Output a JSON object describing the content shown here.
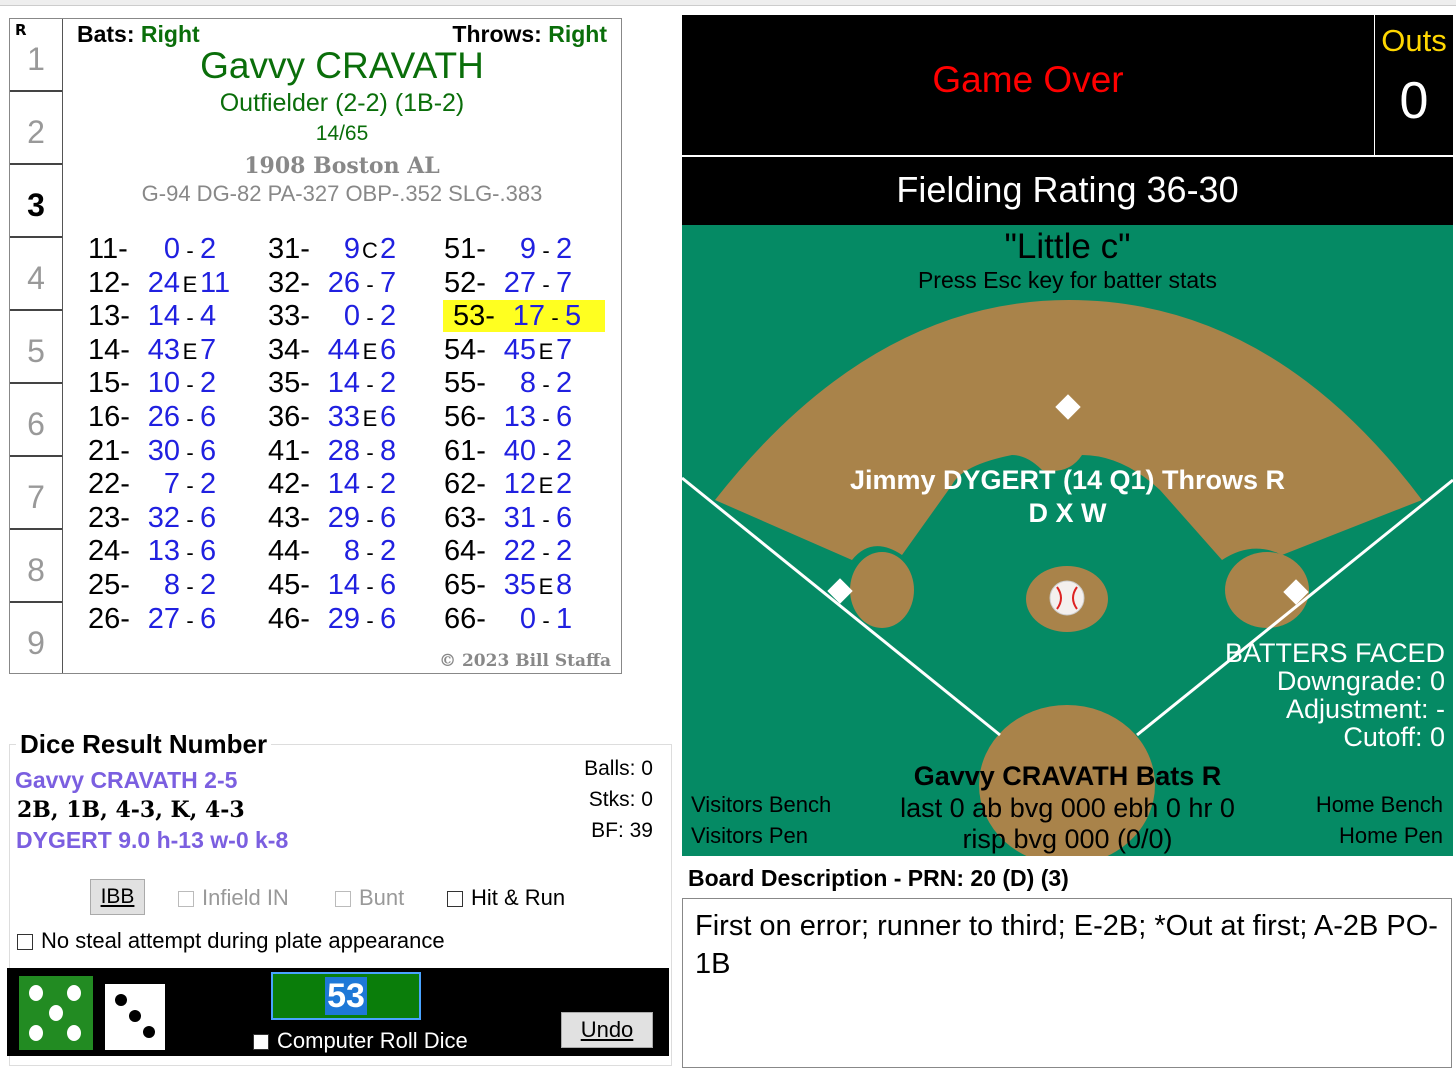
{
  "card": {
    "row_header": "R",
    "row_numbers": [
      "1",
      "2",
      "3",
      "4",
      "5",
      "6",
      "7",
      "8",
      "9"
    ],
    "selected_row": "3",
    "bats_label": "Bats:",
    "bats_value": "Right",
    "throws_label": "Throws:",
    "throws_value": "Right",
    "player_name": "Gavvy CRAVATH",
    "position": "Outfielder (2-2) (1B-2)",
    "ratio": "14/65",
    "team": "1908 Boston AL",
    "stats": "G-94 DG-82 PA-327 OBP-.352 SLG-.383",
    "copyright": "© 2023 Bill Staffa",
    "highlighted": "53",
    "columns": [
      [
        [
          "11",
          "0",
          "-",
          "2"
        ],
        [
          "12",
          "24",
          "E",
          "11"
        ],
        [
          "13",
          "14",
          "-",
          "4"
        ],
        [
          "14",
          "43",
          "E",
          "7"
        ],
        [
          "15",
          "10",
          "-",
          "2"
        ],
        [
          "16",
          "26",
          "-",
          "6"
        ],
        [
          "21",
          "30",
          "-",
          "6"
        ],
        [
          "22",
          "7",
          "-",
          "2"
        ],
        [
          "23",
          "32",
          "-",
          "6"
        ],
        [
          "24",
          "13",
          "-",
          "6"
        ],
        [
          "25",
          "8",
          "-",
          "2"
        ],
        [
          "26",
          "27",
          "-",
          "6"
        ]
      ],
      [
        [
          "31",
          "9",
          "C",
          "2"
        ],
        [
          "32",
          "26",
          "-",
          "7"
        ],
        [
          "33",
          "0",
          "-",
          "2"
        ],
        [
          "34",
          "44",
          "E",
          "6"
        ],
        [
          "35",
          "14",
          "-",
          "2"
        ],
        [
          "36",
          "33",
          "E",
          "6"
        ],
        [
          "41",
          "28",
          "-",
          "8"
        ],
        [
          "42",
          "14",
          "-",
          "2"
        ],
        [
          "43",
          "29",
          "-",
          "6"
        ],
        [
          "44",
          "8",
          "-",
          "2"
        ],
        [
          "45",
          "14",
          "-",
          "6"
        ],
        [
          "46",
          "29",
          "-",
          "6"
        ]
      ],
      [
        [
          "51",
          "9",
          "-",
          "2"
        ],
        [
          "52",
          "27",
          "-",
          "7"
        ],
        [
          "53",
          "17",
          "-",
          "5"
        ],
        [
          "54",
          "45",
          "E",
          "7"
        ],
        [
          "55",
          "8",
          "-",
          "2"
        ],
        [
          "56",
          "13",
          "-",
          "6"
        ],
        [
          "61",
          "40",
          "-",
          "2"
        ],
        [
          "62",
          "12",
          "E",
          "2"
        ],
        [
          "63",
          "31",
          "-",
          "6"
        ],
        [
          "64",
          "22",
          "-",
          "2"
        ],
        [
          "65",
          "35",
          "E",
          "8"
        ],
        [
          "66",
          "0",
          "-",
          "1"
        ]
      ]
    ]
  },
  "dice": {
    "title": "Dice Result Number",
    "batter_line": "Gavvy CRAVATH  2-5",
    "results_line": "2B, 1B, 4-3, K, 4-3",
    "pitcher_line": "DYGERT  9.0  h-13  w-0  k-8",
    "balls": "Balls: 0",
    "strikes": "Stks: 0",
    "bf": "BF: 39",
    "ibb": "IBB",
    "infield_in": "Infield IN",
    "bunt": "Bunt",
    "hit_run": "Hit & Run",
    "no_steal": "No steal attempt during plate appearance",
    "roll_value": "53",
    "die1": 5,
    "die2": 3,
    "computer_roll": "Computer Roll Dice",
    "undo": "Undo"
  },
  "status": {
    "game_over": "Game Over",
    "outs_label": "Outs",
    "outs_value": "0",
    "fielding_rating": "Fielding Rating 36-30"
  },
  "field": {
    "nickname": "\"Little c\"",
    "hint": "Press Esc key for batter stats",
    "pitcher": "Jimmy DYGERT (14 Q1) Throws R",
    "pitcher_codes": "D X W",
    "bf_title": "BATTERS FACED",
    "downgrade": "Downgrade: 0",
    "adjustment": "Adjustment: -",
    "cutoff": "Cutoff: 0",
    "batter": "Gavvy CRAVATH Bats R",
    "batter_last": "last 0 ab bvg 000 ebh 0 hr 0",
    "batter_risp": "risp bvg 000 (0/0)",
    "visitors_bench": "Visitors Bench",
    "visitors_pen": "Visitors Pen",
    "home_bench": "Home Bench",
    "home_pen": "Home Pen",
    "colors": {
      "grass": "#058a64",
      "dirt": "#a9834a"
    }
  },
  "board": {
    "title": "Board Description - PRN: 20 (D) (3)",
    "text": "First on error; runner to third; E-2B; *Out at first; A-2B PO-1B"
  }
}
